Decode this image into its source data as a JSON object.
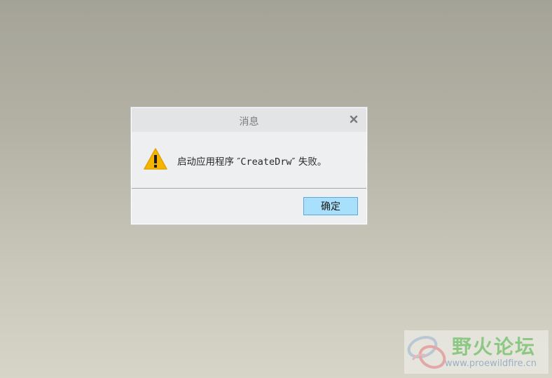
{
  "dialog": {
    "title": "消息",
    "message_prefix": "启动应用程序 ″",
    "app_name": "CreateDrw",
    "message_suffix": "″ 失败。",
    "ok_label": "确定",
    "close_icon": "close-icon",
    "warning_icon": "warning-icon"
  },
  "watermark": {
    "name": "野火论坛",
    "url": "www.proewildfire.cn"
  },
  "colors": {
    "ok_button_bg": "#a8e0fb",
    "ok_button_border": "#5fa9da",
    "warning_yellow": "#f4b400",
    "watermark_green": "#8dc784"
  }
}
